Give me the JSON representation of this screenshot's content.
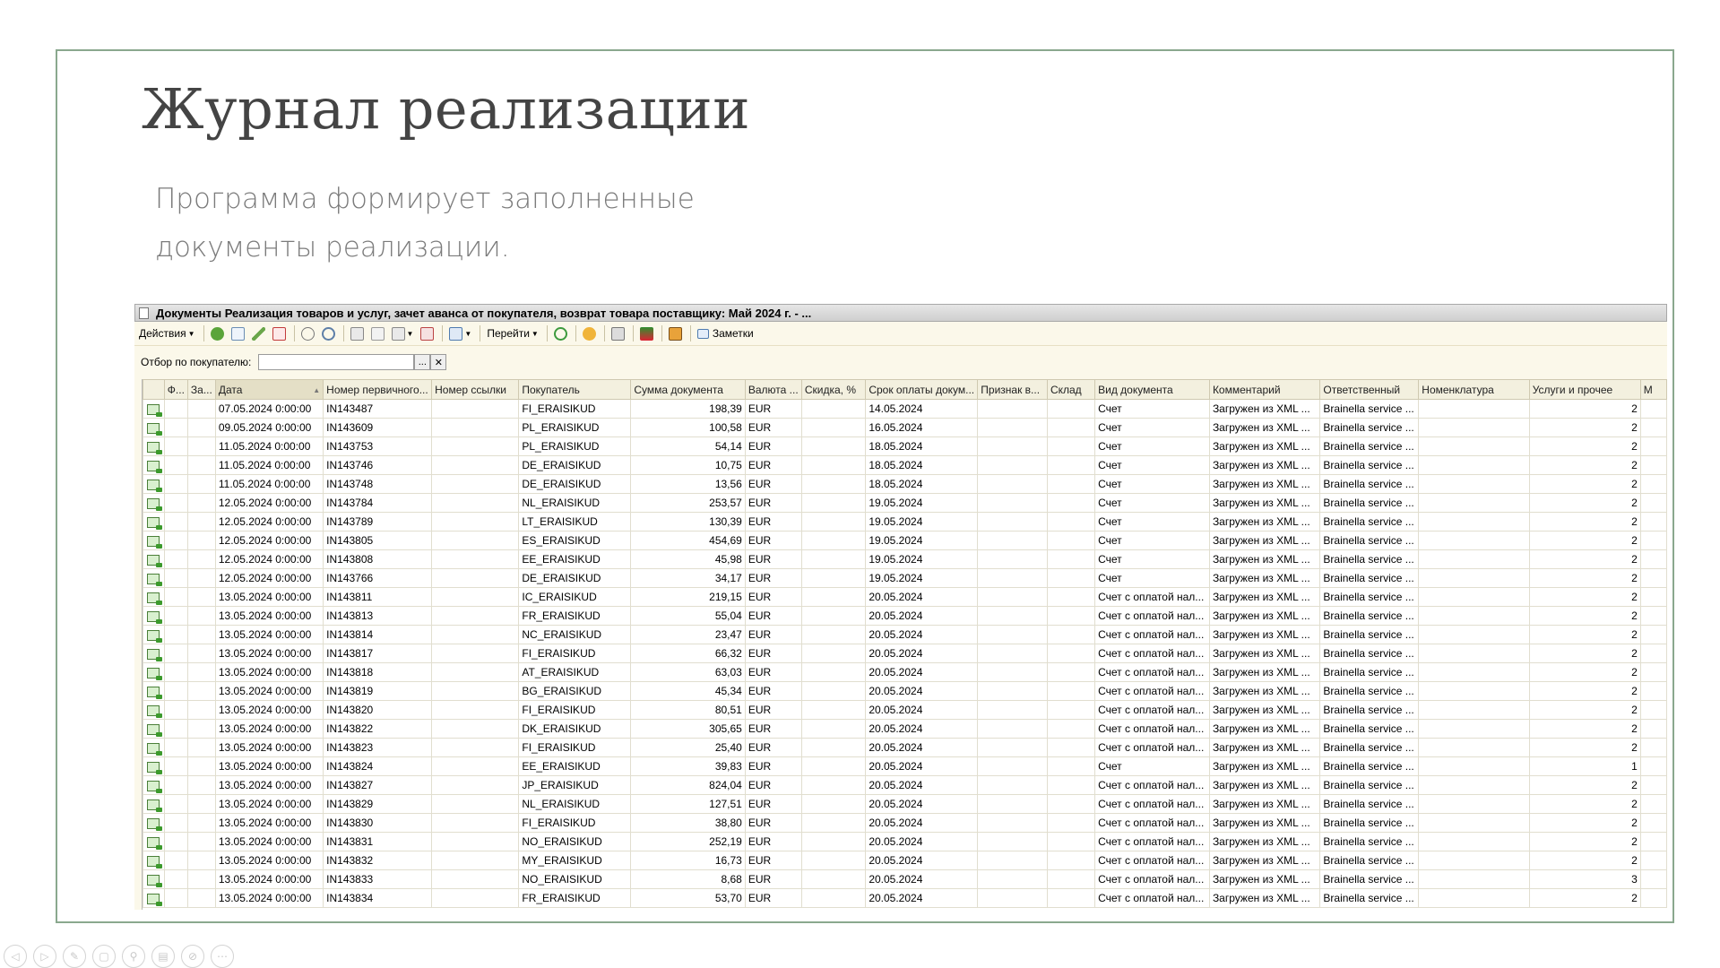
{
  "slide": {
    "title": "Журнал реализации",
    "subtitle": "Программа формирует заполненные документы реализации."
  },
  "window": {
    "title": "Документы Реализация товаров и услуг, зачет аванса от покупателя, возврат товара поставщику: Май 2024 г. - ..."
  },
  "toolbar": {
    "actions_label": "Действия",
    "goto_label": "Перейти",
    "notes_label": "Заметки",
    "icons": [
      "add-icon",
      "copy-icon",
      "edit-icon",
      "delete-icon",
      "toggle-icon",
      "find-icon",
      "filter-icon",
      "filter-list-icon",
      "filter-dropdown-icon",
      "clear-filter-icon",
      "tree-icon",
      "refresh-icon",
      "help-icon",
      "print-icon",
      "spellcheck-icon",
      "house-icon",
      "notes-icon"
    ]
  },
  "filter": {
    "label": "Отбор по покупателю:",
    "value": "",
    "select_label": "...",
    "clear_label": "✕"
  },
  "grid": {
    "columns": [
      "",
      "Ф...",
      "За...",
      "Дата",
      "Номер первичного...",
      "Номер ссылки",
      "Покупатель",
      "Сумма документа",
      "Валюта ...",
      "Скидка, %",
      "Срок оплаты докум...",
      "Признак в...",
      "Склад",
      "Вид документа",
      "Комментарий",
      "Ответственный",
      "Номенклатура",
      "Услуги и прочее",
      "М"
    ],
    "rows": [
      [
        "07.05.2024 0:00:00",
        "IN143487",
        "FI_ERAISIKUD",
        "198,39",
        "EUR",
        "14.05.2024",
        "Счет",
        "Загружен из XML ...",
        "Brainella service ...",
        "2"
      ],
      [
        "09.05.2024 0:00:00",
        "IN143609",
        "PL_ERAISIKUD",
        "100,58",
        "EUR",
        "16.05.2024",
        "Счет",
        "Загружен из XML ...",
        "Brainella service ...",
        "2"
      ],
      [
        "11.05.2024 0:00:00",
        "IN143753",
        "PL_ERAISIKUD",
        "54,14",
        "EUR",
        "18.05.2024",
        "Счет",
        "Загружен из XML ...",
        "Brainella service ...",
        "2"
      ],
      [
        "11.05.2024 0:00:00",
        "IN143746",
        "DE_ERAISIKUD",
        "10,75",
        "EUR",
        "18.05.2024",
        "Счет",
        "Загружен из XML ...",
        "Brainella service ...",
        "2"
      ],
      [
        "11.05.2024 0:00:00",
        "IN143748",
        "DE_ERAISIKUD",
        "13,56",
        "EUR",
        "18.05.2024",
        "Счет",
        "Загружен из XML ...",
        "Brainella service ...",
        "2"
      ],
      [
        "12.05.2024 0:00:00",
        "IN143784",
        "NL_ERAISIKUD",
        "253,57",
        "EUR",
        "19.05.2024",
        "Счет",
        "Загружен из XML ...",
        "Brainella service ...",
        "2"
      ],
      [
        "12.05.2024 0:00:00",
        "IN143789",
        "LT_ERAISIKUD",
        "130,39",
        "EUR",
        "19.05.2024",
        "Счет",
        "Загружен из XML ...",
        "Brainella service ...",
        "2"
      ],
      [
        "12.05.2024 0:00:00",
        "IN143805",
        "ES_ERAISIKUD",
        "454,69",
        "EUR",
        "19.05.2024",
        "Счет",
        "Загружен из XML ...",
        "Brainella service ...",
        "2"
      ],
      [
        "12.05.2024 0:00:00",
        "IN143808",
        "EE_ERAISIKUD",
        "45,98",
        "EUR",
        "19.05.2024",
        "Счет",
        "Загружен из XML ...",
        "Brainella service ...",
        "2"
      ],
      [
        "12.05.2024 0:00:00",
        "IN143766",
        "DE_ERAISIKUD",
        "34,17",
        "EUR",
        "19.05.2024",
        "Счет",
        "Загружен из XML ...",
        "Brainella service ...",
        "2"
      ],
      [
        "13.05.2024 0:00:00",
        "IN143811",
        "IC_ERAISIKUD",
        "219,15",
        "EUR",
        "20.05.2024",
        "Счет с оплатой нал...",
        "Загружен из XML ...",
        "Brainella service ...",
        "2"
      ],
      [
        "13.05.2024 0:00:00",
        "IN143813",
        "FR_ERAISIKUD",
        "55,04",
        "EUR",
        "20.05.2024",
        "Счет с оплатой нал...",
        "Загружен из XML ...",
        "Brainella service ...",
        "2"
      ],
      [
        "13.05.2024 0:00:00",
        "IN143814",
        "NC_ERAISIKUD",
        "23,47",
        "EUR",
        "20.05.2024",
        "Счет с оплатой нал...",
        "Загружен из XML ...",
        "Brainella service ...",
        "2"
      ],
      [
        "13.05.2024 0:00:00",
        "IN143817",
        "FI_ERAISIKUD",
        "66,32",
        "EUR",
        "20.05.2024",
        "Счет с оплатой нал...",
        "Загружен из XML ...",
        "Brainella service ...",
        "2"
      ],
      [
        "13.05.2024 0:00:00",
        "IN143818",
        "AT_ERAISIKUD",
        "63,03",
        "EUR",
        "20.05.2024",
        "Счет с оплатой нал...",
        "Загружен из XML ...",
        "Brainella service ...",
        "2"
      ],
      [
        "13.05.2024 0:00:00",
        "IN143819",
        "BG_ERAISIKUD",
        "45,34",
        "EUR",
        "20.05.2024",
        "Счет с оплатой нал...",
        "Загружен из XML ...",
        "Brainella service ...",
        "2"
      ],
      [
        "13.05.2024 0:00:00",
        "IN143820",
        "FI_ERAISIKUD",
        "80,51",
        "EUR",
        "20.05.2024",
        "Счет с оплатой нал...",
        "Загружен из XML ...",
        "Brainella service ...",
        "2"
      ],
      [
        "13.05.2024 0:00:00",
        "IN143822",
        "DK_ERAISIKUD",
        "305,65",
        "EUR",
        "20.05.2024",
        "Счет с оплатой нал...",
        "Загружен из XML ...",
        "Brainella service ...",
        "2"
      ],
      [
        "13.05.2024 0:00:00",
        "IN143823",
        "FI_ERAISIKUD",
        "25,40",
        "EUR",
        "20.05.2024",
        "Счет с оплатой нал...",
        "Загружен из XML ...",
        "Brainella service ...",
        "2"
      ],
      [
        "13.05.2024 0:00:00",
        "IN143824",
        "EE_ERAISIKUD",
        "39,83",
        "EUR",
        "20.05.2024",
        "Счет",
        "Загружен из XML ...",
        "Brainella service ...",
        "1"
      ],
      [
        "13.05.2024 0:00:00",
        "IN143827",
        "JP_ERAISIKUD",
        "824,04",
        "EUR",
        "20.05.2024",
        "Счет с оплатой нал...",
        "Загружен из XML ...",
        "Brainella service ...",
        "2"
      ],
      [
        "13.05.2024 0:00:00",
        "IN143829",
        "NL_ERAISIKUD",
        "127,51",
        "EUR",
        "20.05.2024",
        "Счет с оплатой нал...",
        "Загружен из XML ...",
        "Brainella service ...",
        "2"
      ],
      [
        "13.05.2024 0:00:00",
        "IN143830",
        "FI_ERAISIKUD",
        "38,80",
        "EUR",
        "20.05.2024",
        "Счет с оплатой нал...",
        "Загружен из XML ...",
        "Brainella service ...",
        "2"
      ],
      [
        "13.05.2024 0:00:00",
        "IN143831",
        "NO_ERAISIKUD",
        "252,19",
        "EUR",
        "20.05.2024",
        "Счет с оплатой нал...",
        "Загружен из XML ...",
        "Brainella service ...",
        "2"
      ],
      [
        "13.05.2024 0:00:00",
        "IN143832",
        "MY_ERAISIKUD",
        "16,73",
        "EUR",
        "20.05.2024",
        "Счет с оплатой нал...",
        "Загружен из XML ...",
        "Brainella service ...",
        "2"
      ],
      [
        "13.05.2024 0:00:00",
        "IN143833",
        "NO_ERAISIKUD",
        "8,68",
        "EUR",
        "20.05.2024",
        "Счет с оплатой нал...",
        "Загружен из XML ...",
        "Brainella service ...",
        "3"
      ],
      [
        "13.05.2024 0:00:00",
        "IN143834",
        "FR_ERAISIKUD",
        "53,70",
        "EUR",
        "20.05.2024",
        "Счет с оплатой нал...",
        "Загружен из XML ...",
        "Brainella service ...",
        "2"
      ]
    ]
  },
  "nav": {
    "icons": [
      "prev-icon",
      "next-icon",
      "pen-icon",
      "copy-slide-icon",
      "zoom-icon",
      "subtitles-icon",
      "hide-icon",
      "more-icon"
    ],
    "glyphs": [
      "◁",
      "▷",
      "✎",
      "▢",
      "⚲",
      "▤",
      "⊘",
      "⋯"
    ]
  }
}
